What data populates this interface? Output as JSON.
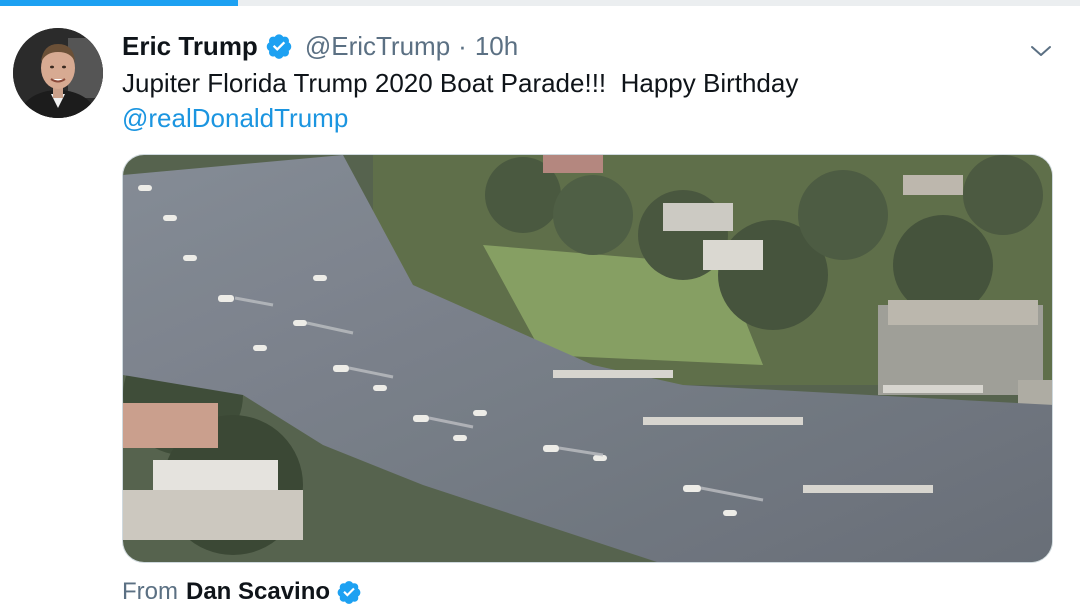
{
  "progress": {
    "fraction": 0.22,
    "color": "#1da1f2"
  },
  "tweet": {
    "author": {
      "display_name": "Eric Trump",
      "handle": "@EricTrump",
      "separator": "·",
      "time": "10h",
      "verified_icon": "verified-badge-icon",
      "avatar_icon": "profile-photo"
    },
    "menu_icon": "chevron-down-icon",
    "text": {
      "line1": "Jupiter Florida Trump 2020 Boat Parade!!!  Happy Birthday",
      "mention": "@realDonaldTrump"
    },
    "media": {
      "kind": "video",
      "description_icon": "aerial-boat-parade-video"
    },
    "source": {
      "label": "From",
      "name": "Dan Scavino",
      "verified_icon": "verified-badge-icon"
    }
  },
  "colors": {
    "accent": "#1da1f2",
    "link": "#1b95e0",
    "secondary_text": "#5b7083",
    "primary_text": "#0f1419"
  }
}
